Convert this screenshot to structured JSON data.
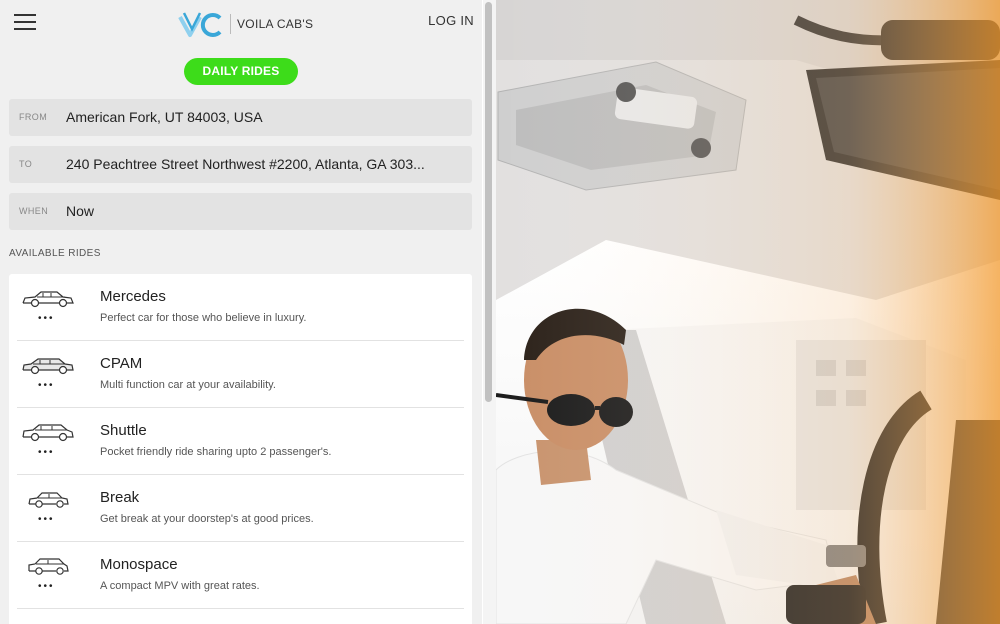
{
  "header": {
    "menu_icon": "hamburger-icon",
    "logo_mark": "VC",
    "brand": "VOILA CAB'S",
    "login": "LOG IN"
  },
  "daily_rides_label": "DAILY RIDES",
  "fields": {
    "from_label": "FROM",
    "from_value": "American Fork, UT 84003, USA",
    "to_label": "TO",
    "to_value": "240 Peachtree Street Northwest #2200, Atlanta, GA 303...",
    "when_label": "WHEN",
    "when_value": "Now"
  },
  "available_title": "AVAILABLE RIDES",
  "rides": [
    {
      "name": "Mercedes",
      "desc": "Perfect car for those who believe in luxury.",
      "icon": "sedan-icon"
    },
    {
      "name": "CPAM",
      "desc": "Multi function car at your availability.",
      "icon": "car-icon"
    },
    {
      "name": "Shuttle",
      "desc": "Pocket friendly ride sharing upto 2 passenger's.",
      "icon": "hatchback-icon"
    },
    {
      "name": "Break",
      "desc": "Get break at your doorstep's at good prices.",
      "icon": "compact-car-icon"
    },
    {
      "name": "Monospace",
      "desc": "A compact MPV with great rates.",
      "icon": "minivan-icon"
    }
  ],
  "colors": {
    "accent": "#3ddc1a",
    "logo_blue": "#3aa7d8",
    "panel_bg": "#f0f0f0",
    "field_bg": "#e3e3e3"
  },
  "photo": {
    "subject": "man in sunglasses driving a car, looking at phone"
  }
}
